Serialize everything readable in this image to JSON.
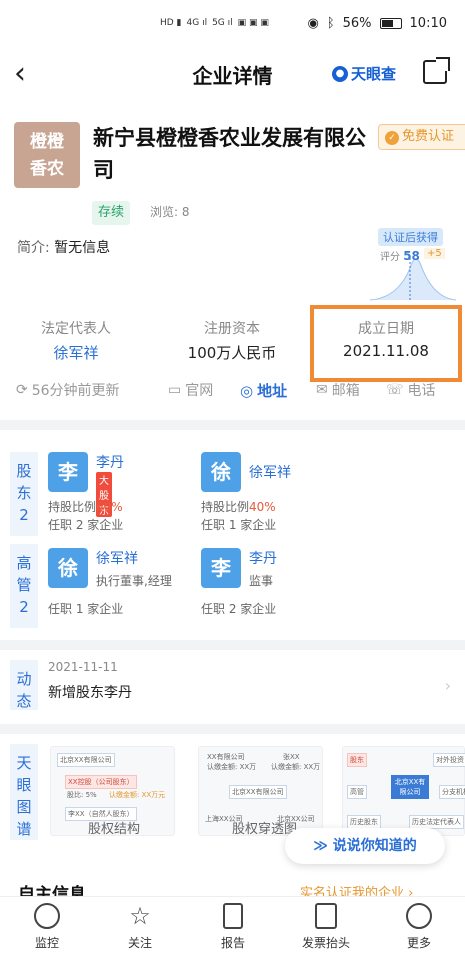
{
  "status_bar": {
    "battery": "56%",
    "time": "10:10"
  },
  "nav": {
    "back": "‹",
    "title": "企业详情",
    "brand": "天眼查"
  },
  "company": {
    "logo_text_1": "橙橙",
    "logo_text_2": "香农",
    "name": "新宁县橙橙香农业发展有限公司",
    "cert_label": "免费认证",
    "status": "存续",
    "views": "浏览: 8",
    "intro_label": "简介:",
    "intro_value": "暂无信息",
    "score_badge": "认证后获得",
    "score_label": "评分",
    "score_value": "58",
    "score_plus": "+5"
  },
  "facts": [
    {
      "key": "法定代表人",
      "value": "徐军祥"
    },
    {
      "key": "注册资本",
      "value": "100万人民币"
    },
    {
      "key": "成立日期",
      "value": "2021.11.08"
    }
  ],
  "links": {
    "updated": "56分钟前更新",
    "website": "官网",
    "address": "地址",
    "email": "邮箱",
    "phone": "电话"
  },
  "shareholders": {
    "side_label": "股\n东\n2",
    "people": [
      {
        "avatar": "李",
        "name": "李丹",
        "badge": "大股东",
        "ratio_label": "持股比例",
        "ratio": "60%",
        "jobs": "任职 2 家企业",
        "color": "#4a9be0"
      },
      {
        "avatar": "徐",
        "name": "徐军祥",
        "ratio_label": "持股比例",
        "ratio": "40%",
        "jobs": "任职 1 家企业",
        "color": "#4a9be0"
      }
    ]
  },
  "executives": {
    "side_label": "高\n管\n2",
    "people": [
      {
        "avatar": "徐",
        "name": "徐军祥",
        "role": "执行董事,经理",
        "jobs": "任职 1 家企业"
      },
      {
        "avatar": "李",
        "name": "李丹",
        "role": "监事",
        "jobs": "任职 2 家企业"
      }
    ]
  },
  "dynamics": {
    "side_label": "动\n态",
    "date": "2021-11-11",
    "text": "新增股东李丹"
  },
  "graph": {
    "side_label": "天\n眼\n图\n谱",
    "tiles": [
      {
        "caption": "股权结构",
        "items": [
          "北京XX有限公司",
          "XX控股（公司股东）",
          "股比: 5%",
          "认缴金额: XX万元",
          "李XX（自然人股东）"
        ]
      },
      {
        "caption": "股权穿透图",
        "items": [
          "XX有限公司",
          "认缴金额: XX万",
          "张XX",
          "认缴金额: XX万",
          "北京XX有限公司",
          "上海XX公司",
          "北京XX公司"
        ]
      },
      {
        "caption": "企业图谱",
        "items": [
          "股东",
          "对外投资",
          "高管",
          "北京XX有限公司",
          "分支机构",
          "历史股东",
          "历史法定代表人"
        ]
      }
    ]
  },
  "feedback": "说说你知道的",
  "section": {
    "title": "自主信息",
    "right": "实名认证我的企业 ›"
  },
  "tabbar": [
    "监控",
    "关注",
    "报告",
    "发票抬头",
    "更多"
  ],
  "colors": {
    "accent": "#2a6fd6",
    "highlight": "#f08a34",
    "active_status": "#2aa36b"
  }
}
